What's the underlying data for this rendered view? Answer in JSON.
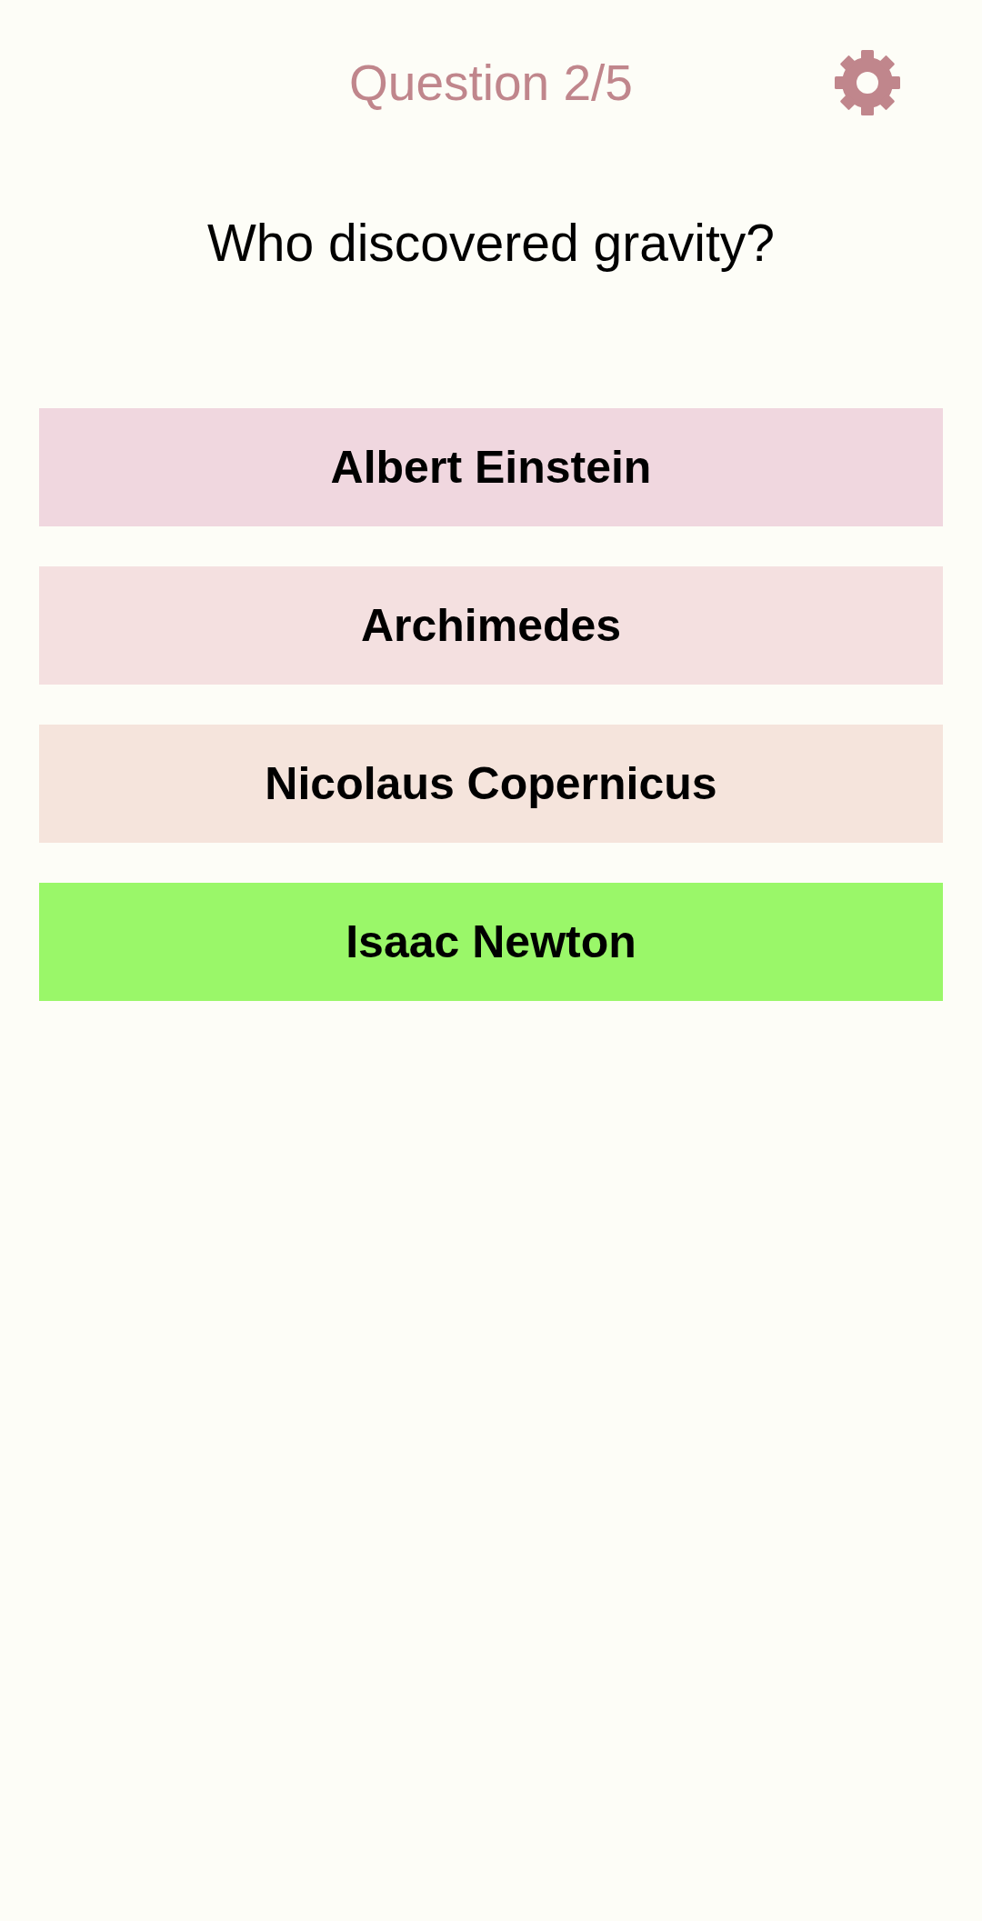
{
  "header": {
    "title": "Question 2/5"
  },
  "question": "Who discovered gravity?",
  "options": [
    {
      "label": "Albert Einstein",
      "color": "#f0d7df"
    },
    {
      "label": "Archimedes",
      "color": "#f4e0e0"
    },
    {
      "label": "Nicolaus Copernicus",
      "color": "#f5e4dc"
    },
    {
      "label": "Isaac Newton",
      "color": "#9af769"
    }
  ]
}
